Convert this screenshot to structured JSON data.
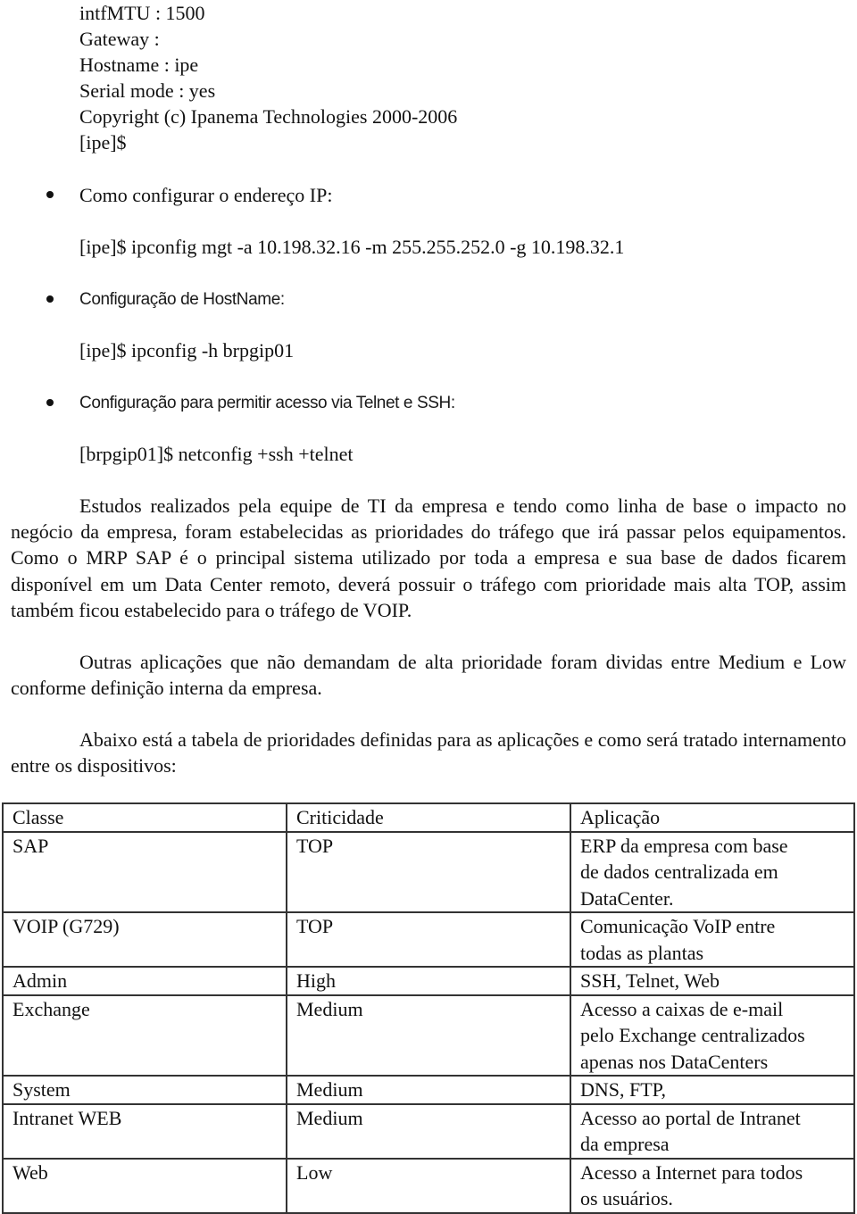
{
  "terminal_output": {
    "lines": [
      "intfMTU : 1500",
      "Gateway :",
      "Hostname : ipe",
      "Serial mode : yes",
      "Copyright (c) Ipanema Technologies 2000-2006",
      "[ipe]$"
    ]
  },
  "steps": [
    {
      "title": "Como configurar o endereço IP:",
      "command": "[ipe]$ ipconfig mgt -a 10.198.32.16 -m 255.255.252.0 -g 10.198.32.1"
    },
    {
      "title": "Configuração de HostName:",
      "command": "[ipe]$ ipconfig -h brpgip01"
    },
    {
      "title": "Configuração para permitir acesso via Telnet e SSH:",
      "command": "[brpgip01]$ netconfig +ssh +telnet"
    }
  ],
  "paragraphs": {
    "studies": "Estudos realizados pela equipe de TI da empresa e tendo como linha de base o impacto no negócio da empresa, foram estabelecidas as prioridades do tráfego que irá passar pelos equipamentos. Como o MRP SAP é o principal sistema utilizado por toda a empresa e sua base de dados ficarem disponível em um Data Center remoto, deverá possuir o tráfego com prioridade mais alta TOP, assim também ficou estabelecido para o tráfego de VOIP.",
    "others": "Outras aplicações que não demandam de alta prioridade foram dividas entre Medium e Low conforme definição interna da empresa.",
    "table_intro": "Abaixo está a tabela de prioridades definidas para as aplicações e como será tratado internamento entre os dispositivos:"
  },
  "priority_table": {
    "headers": [
      "Classe",
      "Criticidade",
      "Aplicação"
    ],
    "rows": [
      {
        "classe": "SAP",
        "criticidade": "TOP",
        "aplicacao": [
          "ERP da empresa com base",
          "de dados centralizada em",
          "DataCenter."
        ]
      },
      {
        "classe": "VOIP (G729)",
        "criticidade": "TOP",
        "aplicacao": [
          "Comunicação VoIP entre",
          "todas as plantas"
        ]
      },
      {
        "classe": "Admin",
        "criticidade": "High",
        "aplicacao": [
          "SSH, Telnet, Web"
        ]
      },
      {
        "classe": "Exchange",
        "criticidade": "Medium",
        "aplicacao": [
          "Acesso a caixas de e-mail",
          "pelo Exchange centralizados",
          "apenas nos DataCenters"
        ]
      },
      {
        "classe": "System",
        "criticidade": "Medium",
        "aplicacao": [
          "DNS, FTP,"
        ]
      },
      {
        "classe": "Intranet WEB",
        "criticidade": "Medium",
        "aplicacao": [
          "Acesso ao portal de Intranet",
          "da empresa"
        ]
      },
      {
        "classe": "Web",
        "criticidade": "Low",
        "aplicacao": [
          "Acesso a Internet para todos",
          "os usuários."
        ]
      }
    ]
  }
}
